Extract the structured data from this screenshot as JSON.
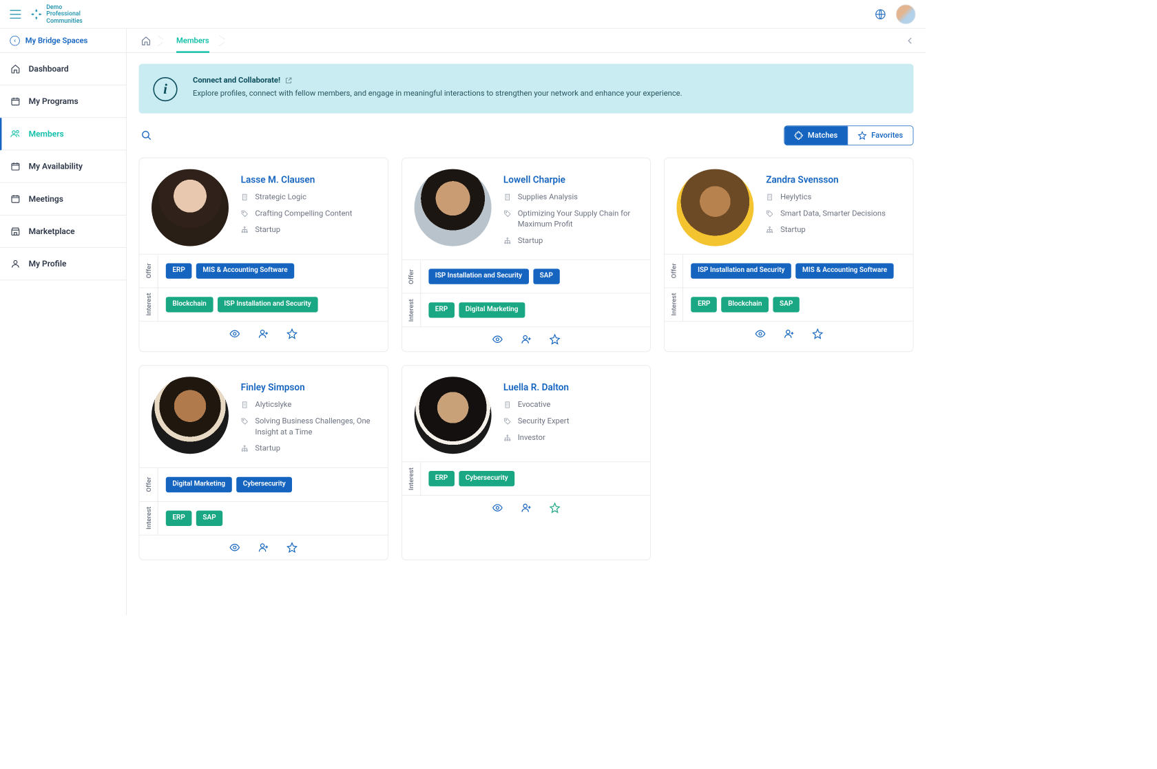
{
  "header": {
    "brand_line1": "Demo",
    "brand_line2": "Professional",
    "brand_line3": "Communities"
  },
  "sidebar": {
    "back_label": "My Bridge Spaces",
    "items": [
      {
        "label": "Dashboard",
        "icon": "home"
      },
      {
        "label": "My Programs",
        "icon": "calendar"
      },
      {
        "label": "Members",
        "icon": "users",
        "active": true
      },
      {
        "label": "My Availability",
        "icon": "calendar"
      },
      {
        "label": "Meetings",
        "icon": "calendar"
      },
      {
        "label": "Marketplace",
        "icon": "store"
      },
      {
        "label": "My Profile",
        "icon": "person"
      }
    ]
  },
  "breadcrumb": {
    "current": "Members"
  },
  "banner": {
    "title": "Connect and Collaborate!",
    "text": "Explore profiles, connect with fellow members, and engage in meaningful interactions to strengthen your network and enhance your experience."
  },
  "toolbar": {
    "matches_label": "Matches",
    "favorites_label": "Favorites"
  },
  "labels": {
    "offer": "Offer",
    "interest": "Interest"
  },
  "members": [
    {
      "name": "Lasse M. Clausen",
      "company": "Strategic Logic",
      "tagline": "Crafting Compelling Content",
      "type": "Startup",
      "offers": [
        "ERP",
        "MIS & Accounting Software"
      ],
      "interests": [
        "Blockchain",
        "ISP Installation and Security"
      ],
      "avatar_class": "av1",
      "favorited": false
    },
    {
      "name": "Lowell Charpie",
      "company": "Supplies Analysis",
      "tagline": "Optimizing Your Supply Chain for Maximum Profit",
      "type": "Startup",
      "offers": [
        "ISP Installation and Security",
        "SAP"
      ],
      "interests": [
        "ERP",
        "Digital Marketing"
      ],
      "avatar_class": "av2",
      "favorited": false
    },
    {
      "name": "Zandra Svensson",
      "company": "Heylytics",
      "tagline": "Smart Data, Smarter Decisions",
      "type": "Startup",
      "offers": [
        "ISP Installation and Security",
        "MIS & Accounting Software"
      ],
      "interests": [
        "ERP",
        "Blockchain",
        "SAP"
      ],
      "avatar_class": "av3",
      "favorited": false
    },
    {
      "name": "Finley Simpson",
      "company": "Alyticslyke",
      "tagline": "Solving Business Challenges, One Insight at a Time",
      "type": "Startup",
      "offers": [
        "Digital Marketing",
        "Cybersecurity"
      ],
      "interests": [
        "ERP",
        "SAP"
      ],
      "avatar_class": "av4",
      "favorited": false
    },
    {
      "name": "Luella R. Dalton",
      "company": "Evocative",
      "tagline": "Security Expert",
      "type": "Investor",
      "offers": [],
      "interests": [
        "ERP",
        "Cybersecurity"
      ],
      "avatar_class": "av5",
      "favorited": true,
      "hide_offer": true
    }
  ]
}
